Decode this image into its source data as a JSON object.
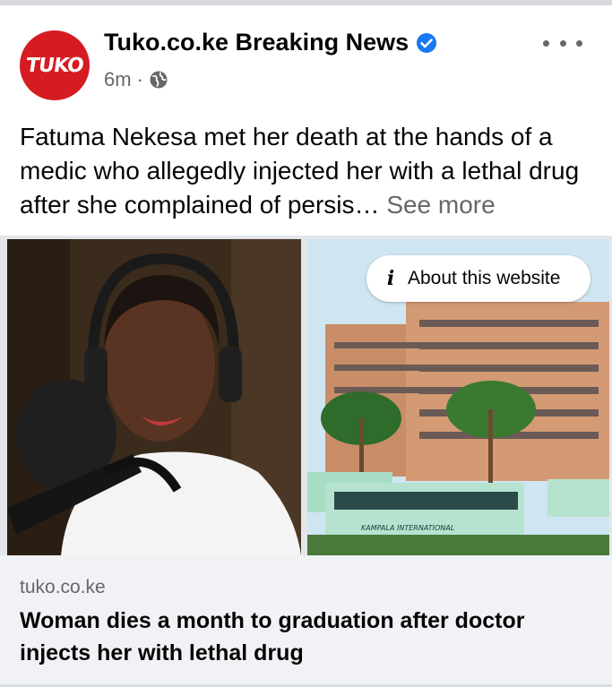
{
  "post": {
    "avatar_text": "TUKO",
    "page_name": "Tuko.co.ke Breaking News",
    "time": "6m",
    "separator": "·",
    "text": "Fatuma Nekesa met her death at the hands of a medic who allegedly injected her with a lethal drug after she complained of persis… ",
    "see_more": "See more"
  },
  "images": {
    "about_label": "About this website",
    "bus_sign": "KAMPALA INTERNATIONAL"
  },
  "link_preview": {
    "domain": "tuko.co.ke",
    "title": "Woman dies a month to graduation after doctor injects her with lethal drug"
  },
  "colors": {
    "brand_red": "#d61c22",
    "verified_blue": "#1877f2",
    "secondary_text": "#65676b",
    "preview_bg": "#f0f2f5"
  },
  "icons": {
    "verified": "verified-badge-icon",
    "globe": "globe-icon",
    "more": "more-options-icon",
    "info": "info-icon"
  }
}
